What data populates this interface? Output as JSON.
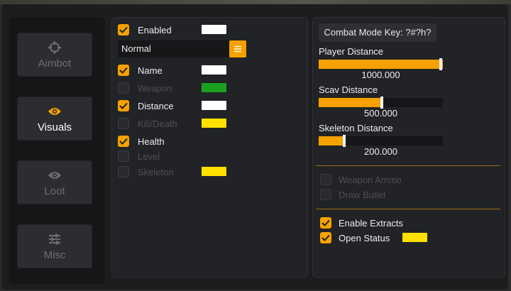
{
  "sidebar": {
    "items": [
      {
        "label": "Aimbot",
        "icon": "crosshair-icon",
        "active": false
      },
      {
        "label": "Visuals",
        "icon": "eye-icon",
        "active": true
      },
      {
        "label": "Loot",
        "icon": "eye-icon",
        "active": false
      },
      {
        "label": "Misc",
        "icon": "sliders-icon",
        "active": false
      }
    ]
  },
  "visuals": {
    "enabled": {
      "label": "Enabled",
      "checked": true,
      "color": "#ffffff"
    },
    "box_style": {
      "value": "Normal",
      "button_icon": "menu-icon"
    },
    "options": [
      {
        "label": "Name",
        "checked": true,
        "color": "#ffffff"
      },
      {
        "label": "Weapon",
        "checked": false,
        "color": "#1aa11f"
      },
      {
        "label": "Distance",
        "checked": true,
        "color": "#ffffff"
      },
      {
        "label": "Kill/Death",
        "checked": false,
        "color": "#ffe000"
      },
      {
        "label": "Health",
        "checked": true,
        "color": null
      },
      {
        "label": "Level",
        "checked": false,
        "color": null
      },
      {
        "label": "Skeleton",
        "checked": false,
        "color": "#ffe000"
      }
    ]
  },
  "settings": {
    "combat_key_label": "Combat Mode Key: ?#?h?",
    "sliders": [
      {
        "label": "Player Distance",
        "value": "1000.000",
        "fraction": 1.0
      },
      {
        "label": "Scav Distance",
        "value": "500.000",
        "fraction": 0.5
      },
      {
        "label": "Skeleton Distance",
        "value": "200.000",
        "fraction": 0.2
      }
    ],
    "weapon_options": [
      {
        "label": "Weapon Ammo",
        "checked": false
      },
      {
        "label": "Draw Bullet",
        "checked": false
      }
    ],
    "extract_options": [
      {
        "label": "Enable Extracts",
        "checked": true
      },
      {
        "label": "Open Status",
        "checked": true,
        "color": "#ffe000"
      }
    ]
  },
  "colors": {
    "accent": "#f5a100",
    "window_bg": "#1c1d1f",
    "panel_bg": "#222326"
  }
}
